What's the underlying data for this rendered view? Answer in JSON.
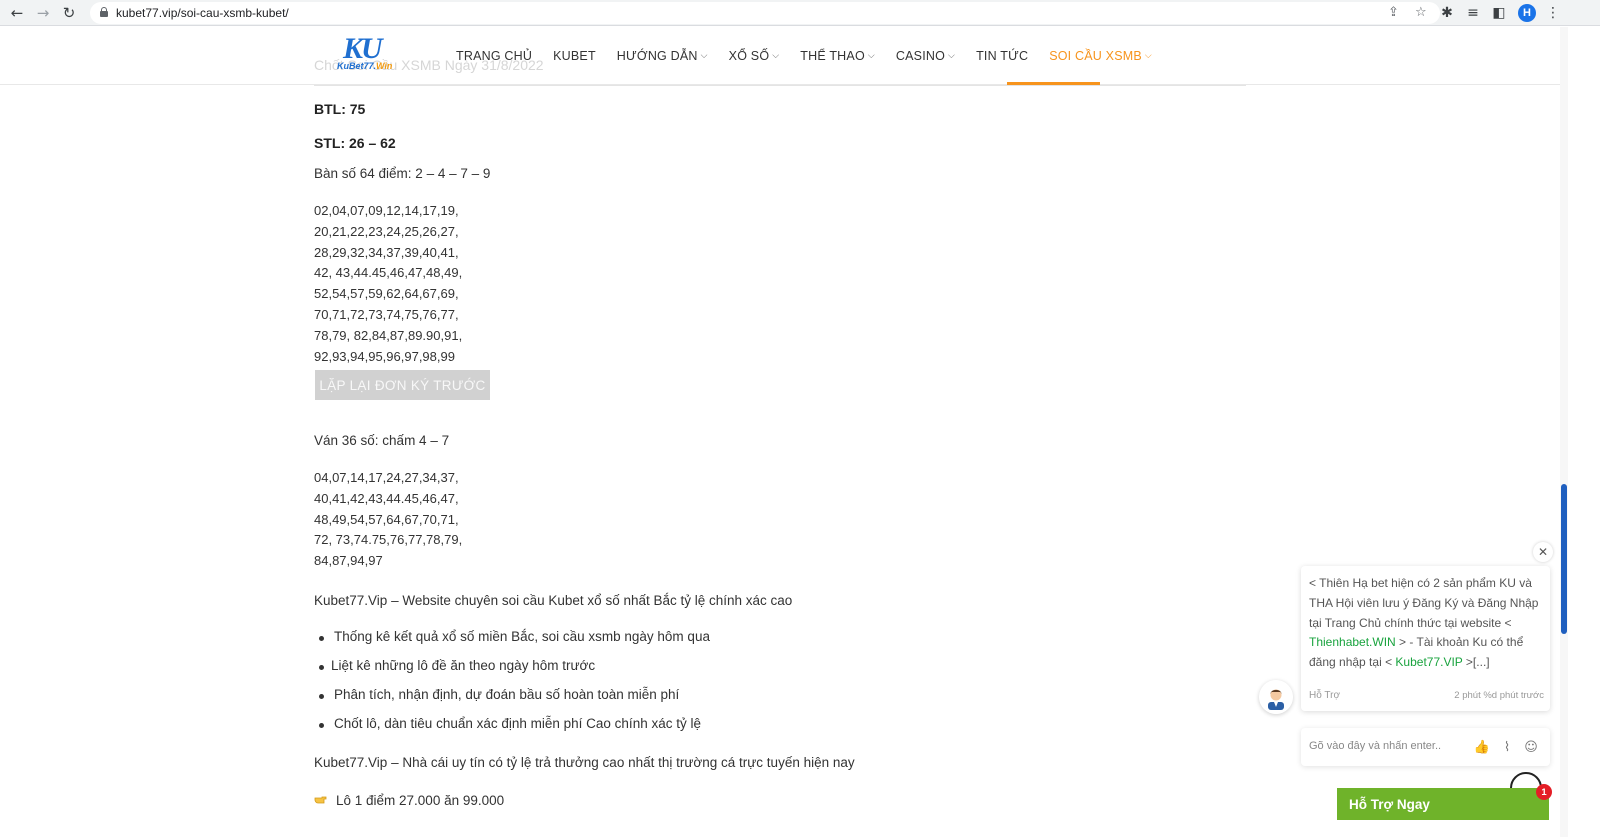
{
  "browser": {
    "url": "kubet77.vip/soi-cau-xsmb-kubet/",
    "profile_initial": "H",
    "icons": [
      "back-icon",
      "forward-icon",
      "reload-icon",
      "lock-icon",
      "share-icon",
      "star-icon",
      "extensions-icon",
      "media-icon",
      "sidepanel-icon",
      "menu-icon"
    ]
  },
  "header": {
    "ghost_heading": "Chốt Soi Cầu XSMB Ngày 31/8/2022",
    "logo": {
      "main": "KU",
      "sub_prefix": "KuBet77.",
      "sub_suffix": "Win"
    },
    "menu": [
      {
        "label": "TRANG CHỦ",
        "dropdown": false
      },
      {
        "label": "KUBET",
        "dropdown": false
      },
      {
        "label": "HƯỚNG DẪN",
        "dropdown": true
      },
      {
        "label": "XỔ SỐ",
        "dropdown": true
      },
      {
        "label": "THỂ THAO",
        "dropdown": true
      },
      {
        "label": "CASINO",
        "dropdown": true
      },
      {
        "label": "TIN TỨC",
        "dropdown": false
      },
      {
        "label": "SOI CẦU XSMB",
        "dropdown": true,
        "active": true
      }
    ],
    "caret": "⌵",
    "accent_color": "#f7941d"
  },
  "content": {
    "btl": "BTL: 75",
    "stl": "STL: 26 – 62",
    "ban64_title": "Bàn số 64 điểm: 2 – 4 – 7 – 9",
    "ban64_lines": [
      "02,04,07,09,12,14,17,19,",
      "20,21,22,23,24,25,26,27,",
      "28,29,32,34,37,39,40,41,",
      "42, 43,44.45,46,47,48,49,",
      "52,54,57,59,62,64,67,69,",
      "70,71,72,73,74,75,76,77,",
      "78,79, 82,84,87,89.90,91,",
      "92,93,94,95,96,97,98,99"
    ],
    "repeat_button": "LẶP LẠI ĐƠN KÝ TRƯỚC",
    "van36_title": "Ván 36 số: chấm 4 – 7",
    "van36_lines": [
      "04,07,14,17,24,27,34,37,",
      "40,41,42,43,44.45,46,47,",
      "48,49,54,57,64,67,70,71,",
      "72, 73,74.75,76,77,78,79,",
      "84,87,94,97"
    ],
    "intro": "Kubet77.Vip – Website chuyên soi cầu Kubet xổ số nhất Bắc tỷ lệ chính xác cao",
    "bullets": [
      "Thống kê kết quả xổ số miền Bắc, soi cầu xsmb ngày hôm qua",
      "Liệt kê những lô đề ăn theo ngày hôm trước",
      "Phân tích, nhận định, dự đoán bầu số hoàn toàn miễn phí",
      "Chốt lô, dàn tiêu chuẩn xác định miễn phí Cao chính xác tỷ lệ"
    ],
    "outro": "Kubet77.Vip – Nhà cái uy tín có tỷ lệ trả thưởng cao nhất thị trường cá trực tuyến hiện nay",
    "lo_line": "Lô 1 điểm 27.000 ăn 99.000"
  },
  "chat": {
    "message_part1": "< Thiên Hạ bet hiện có 2 sản phẩm KU và THA Hội viên lưu ý Đăng Ký và Đăng Nhập tại Trang Chủ chính thức tại website < ",
    "link1": "Thienhabet.WIN",
    "message_part2": " > - Tài khoản Ku có thể đăng nhập tại < ",
    "link2": "Kubet77.VIP",
    "message_part3": " >[...]",
    "author": "Hỗ Trợ",
    "time": "2 phút %d phút trước",
    "input_placeholder": "Gõ vào đây và nhấn enter..",
    "support_button": "Hỗ Trợ Ngay",
    "badge_count": "1",
    "close_glyph": "✕",
    "link_color": "#19a33e",
    "support_color": "#6fb32a"
  }
}
